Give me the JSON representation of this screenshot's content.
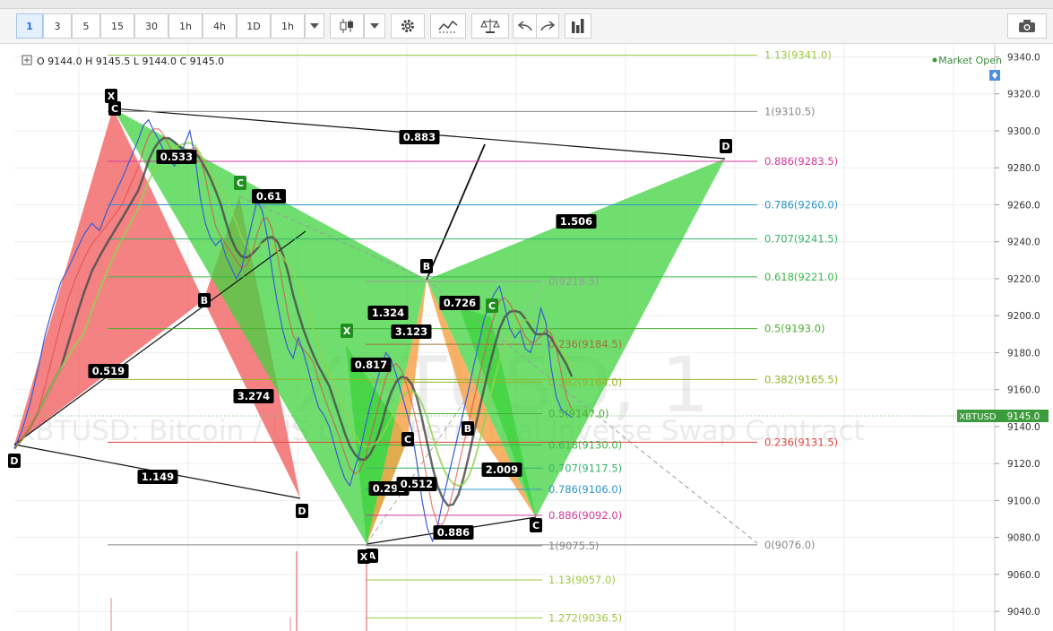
{
  "toolbar": {
    "intervals": [
      "1",
      "3",
      "5",
      "15",
      "30",
      "1h",
      "4h",
      "1D",
      "1h"
    ],
    "active_interval": "1",
    "icons": [
      "dropdown-chevron-icon",
      "candle-style-icon",
      "chevron-down-icon",
      "gear-icon",
      "indicators-icon",
      "compare-scale-icon",
      "undo-icon",
      "redo-icon",
      "bar-chart-icon",
      "camera-icon"
    ]
  },
  "legend": {
    "ohlc": "O 9144.0  H 9145.5  L 9144.0  C 9145.0",
    "market_status": "Market Open"
  },
  "watermark": {
    "big": "XBTUSD, 1",
    "sub": "XBTUSD: Bitcoin / US Dollar Perpetual Inverse Swap Contract"
  },
  "price_tag": {
    "symbol": "XBTUSD",
    "price": "9145.0"
  },
  "colors": {
    "green": "#3fd33f",
    "red": "#f25858",
    "orange": "#f7a34b",
    "accent": "#2a6fdb",
    "label_bg": "#000000"
  },
  "chart_data": {
    "type": "line",
    "ylim": [
      9032,
      9345
    ],
    "yticks": [
      9340.0,
      9320.0,
      9300.0,
      9280.0,
      9260.0,
      9240.0,
      9220.0,
      9200.0,
      9180.0,
      9160.0,
      9140.0,
      9120.0,
      9100.0,
      9080.0,
      9060.0,
      9040.0
    ],
    "fib_right": [
      {
        "label": "1.13(9341.0)",
        "price": 9341.0,
        "color": "#9fc73f"
      },
      {
        "label": "1(9310.5)",
        "price": 9310.5,
        "color": "#888888"
      },
      {
        "label": "0.886(9283.5)",
        "price": 9283.5,
        "color": "#d2389c"
      },
      {
        "label": "0.786(9260.0)",
        "price": 9260.0,
        "color": "#2b95c8"
      },
      {
        "label": "0.707(9241.5)",
        "price": 9241.5,
        "color": "#34b46a"
      },
      {
        "label": "0.618(9221.0)",
        "price": 9221.0,
        "color": "#3bb54a"
      },
      {
        "label": "0.5(9193.0)",
        "price": 9193.0,
        "color": "#4cae32"
      },
      {
        "label": "0.382(9165.5)",
        "price": 9165.5,
        "color": "#94b529"
      },
      {
        "label": "0.236(9131.5)",
        "price": 9131.5,
        "color": "#e0433a"
      },
      {
        "label": "0(9076.0)",
        "price": 9076.0,
        "color": "#888888"
      }
    ],
    "fib_mid": [
      {
        "label": "0(9218.5)",
        "price": 9218.5,
        "color": "#999999"
      },
      {
        "label": "0.236(9184.5)",
        "price": 9184.5,
        "color": "#a0703a"
      },
      {
        "label": "0.382(9164.0)",
        "price": 9164.0,
        "color": "#94b529"
      },
      {
        "label": "0.5(9147.0)",
        "price": 9147.0,
        "color": "#4cae32"
      },
      {
        "label": "0.618(9130.0)",
        "price": 9130.0,
        "color": "#3bb54a"
      },
      {
        "label": "0.707(9117.5)",
        "price": 9117.5,
        "color": "#34b46a"
      },
      {
        "label": "0.786(9106.0)",
        "price": 9106.0,
        "color": "#2b95c8"
      },
      {
        "label": "0.886(9092.0)",
        "price": 9092.0,
        "color": "#d2389c"
      },
      {
        "label": "1(9075.5)",
        "price": 9075.5,
        "color": "#888888"
      },
      {
        "label": "1.13(9057.0)",
        "price": 9057.0,
        "color": "#9fc73f"
      },
      {
        "label": "1.272(9036.5)",
        "price": 9036.5,
        "color": "#9fc73f"
      }
    ],
    "ratios": [
      "0.883",
      "0.533",
      "0.61",
      "1.506",
      "0.519",
      "3.274",
      "1.149",
      "1.324",
      "3.123",
      "0.817",
      "0.726",
      "0.292",
      "0.512",
      "2.009",
      "0.886"
    ],
    "points": [
      "X",
      "C",
      "D",
      "B",
      "X",
      "B",
      "C",
      "C",
      "B",
      "C",
      "D",
      "A",
      "X",
      "D",
      "C"
    ],
    "price_series": [
      [
        0,
        9128
      ],
      [
        3,
        9138
      ],
      [
        6,
        9152
      ],
      [
        9,
        9170
      ],
      [
        12,
        9190
      ],
      [
        15,
        9205
      ],
      [
        18,
        9218
      ],
      [
        21,
        9226
      ],
      [
        24,
        9235
      ],
      [
        27,
        9244
      ],
      [
        30,
        9250
      ],
      [
        33,
        9246
      ],
      [
        36,
        9257
      ],
      [
        39,
        9266
      ],
      [
        42,
        9275
      ],
      [
        45,
        9285
      ],
      [
        48,
        9295
      ],
      [
        50,
        9303
      ],
      [
        52,
        9306
      ],
      [
        54,
        9300
      ],
      [
        56,
        9295
      ],
      [
        58,
        9289
      ],
      [
        60,
        9284
      ],
      [
        62,
        9281
      ],
      [
        64,
        9285
      ],
      [
        66,
        9293
      ],
      [
        68,
        9300
      ],
      [
        70,
        9286
      ],
      [
        72,
        9264
      ],
      [
        74,
        9250
      ],
      [
        76,
        9242
      ],
      [
        78,
        9238
      ],
      [
        80,
        9241
      ],
      [
        82,
        9232
      ],
      [
        84,
        9226
      ],
      [
        86,
        9220
      ],
      [
        88,
        9225
      ],
      [
        90,
        9238
      ],
      [
        92,
        9250
      ],
      [
        94,
        9262
      ],
      [
        96,
        9257
      ],
      [
        98,
        9243
      ],
      [
        100,
        9223
      ],
      [
        102,
        9206
      ],
      [
        104,
        9192
      ],
      [
        106,
        9182
      ],
      [
        108,
        9177
      ],
      [
        110,
        9188
      ],
      [
        112,
        9180
      ],
      [
        114,
        9170
      ],
      [
        116,
        9159
      ],
      [
        118,
        9150
      ],
      [
        120,
        9146
      ],
      [
        122,
        9140
      ],
      [
        124,
        9130
      ],
      [
        126,
        9120
      ],
      [
        128,
        9112
      ],
      [
        130,
        9108
      ],
      [
        132,
        9118
      ],
      [
        134,
        9127
      ],
      [
        136,
        9140
      ],
      [
        138,
        9152
      ],
      [
        140,
        9162
      ],
      [
        142,
        9172
      ],
      [
        144,
        9180
      ],
      [
        146,
        9176
      ],
      [
        148,
        9168
      ],
      [
        150,
        9158
      ],
      [
        152,
        9148
      ],
      [
        154,
        9138
      ],
      [
        156,
        9120
      ],
      [
        158,
        9100
      ],
      [
        160,
        9085
      ],
      [
        162,
        9078
      ],
      [
        164,
        9086
      ],
      [
        166,
        9100
      ],
      [
        168,
        9112
      ],
      [
        170,
        9124
      ],
      [
        172,
        9136
      ],
      [
        174,
        9148
      ],
      [
        176,
        9160
      ],
      [
        178,
        9173
      ],
      [
        180,
        9185
      ],
      [
        182,
        9198
      ],
      [
        184,
        9206
      ],
      [
        186,
        9212
      ],
      [
        188,
        9216
      ],
      [
        190,
        9205
      ],
      [
        192,
        9193
      ],
      [
        194,
        9188
      ],
      [
        196,
        9192
      ],
      [
        198,
        9182
      ],
      [
        200,
        9180
      ],
      [
        202,
        9190
      ],
      [
        204,
        9204
      ],
      [
        206,
        9196
      ],
      [
        208,
        9172
      ],
      [
        210,
        9156
      ],
      [
        212,
        9149
      ],
      [
        214,
        9147
      ],
      [
        216,
        9145
      ]
    ],
    "series": [
      {
        "name": "",
        "color": "#5a5a5a"
      },
      {
        "name": "",
        "color": "#8ed44f"
      },
      {
        "name": "",
        "color": "#e04545"
      }
    ]
  }
}
